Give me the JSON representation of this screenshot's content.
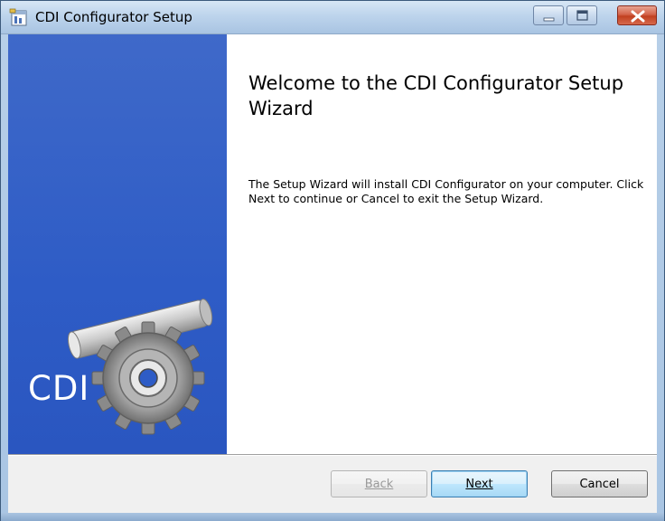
{
  "window": {
    "title": "CDI Configurator Setup",
    "icon": "setup-icon",
    "controls": {
      "minimize": "minimize-icon",
      "maximize": "maximize-icon",
      "close": "close-icon"
    }
  },
  "banner": {
    "logo_text": "CDI",
    "logo_icon": "gear-icon",
    "color": "#2e5cc6"
  },
  "main": {
    "heading": "Welcome to the CDI Configurator Setup Wizard",
    "body": "The Setup Wizard will install CDI Configurator on your computer. Click Next to continue or Cancel to exit the Setup Wizard."
  },
  "buttons": {
    "back": {
      "label": "Back",
      "enabled": false
    },
    "next": {
      "label": "Next",
      "enabled": true
    },
    "cancel": {
      "label": "Cancel",
      "enabled": true
    }
  }
}
